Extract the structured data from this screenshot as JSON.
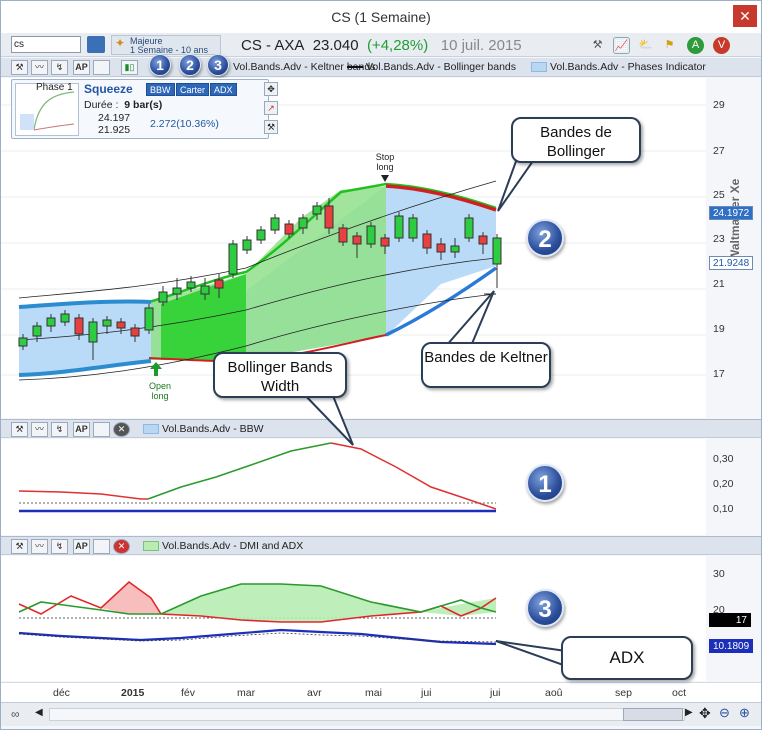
{
  "window": {
    "title": "CS (1 Semaine)",
    "close": "✕"
  },
  "topbar": {
    "symbol_input": "cs",
    "majeure_title": "Majeure",
    "majeure_sub": "1 Semaine - 10 ans",
    "quote_name": "CS - AXA",
    "quote_price": "23.040",
    "quote_change": "(+4,28%)",
    "quote_date": "10 juil. 2015"
  },
  "toolbar": {
    "ap_label": "AP",
    "legend_keltner": "Vol.Bands.Adv - Keltner bands",
    "legend_bollinger": "Vol.Bands.Adv - Bollinger bands",
    "legend_phases": "Vol.Bands.Adv - Phases Indicator"
  },
  "info_panel": {
    "phase": "Phase 1",
    "title": "Squeeze",
    "tabs": [
      "BBW",
      "Carter",
      "ADX"
    ],
    "duration_label": "Durée :",
    "duration_value": "9 bar(s)",
    "upper": "24.197",
    "lower": "21.925",
    "change": "2.272(10.36%)"
  },
  "main_chart": {
    "y_ticks": [
      "29",
      "27",
      "25",
      "23",
      "21",
      "19",
      "17"
    ],
    "price_upper": "24.1972",
    "price_lower": "21.9248",
    "stop_label": "Stop",
    "stop_sub": "long",
    "open_label": "Open",
    "open_sub": "long",
    "watermark": "Waltmaster Xe"
  },
  "bbw_pane": {
    "legend": "Vol.Bands.Adv - BBW",
    "y_ticks": [
      "0,30",
      "0,20",
      "0,10"
    ]
  },
  "dmi_pane": {
    "legend": "Vol.Bands.Adv - DMI and ADX",
    "y_ticks": [
      "30",
      "20"
    ],
    "tag_dmi": "17",
    "tag_adx": "10.1809"
  },
  "x_axis": [
    "déc",
    "2015",
    "fév",
    "mar",
    "avr",
    "mai",
    "jui",
    "jui",
    "aoû",
    "sep",
    "oct"
  ],
  "callouts": {
    "bollinger": "Bandes de Bollinger",
    "keltner": "Bandes de Keltner",
    "bbw": "Bollinger Bands Width",
    "adx": "ADX"
  },
  "badges": [
    "1",
    "2",
    "3"
  ],
  "colors": {
    "bull": "#2aa23a",
    "bear": "#e03030",
    "band_fill": "#b9dbf7",
    "accent": "#2257a5"
  }
}
